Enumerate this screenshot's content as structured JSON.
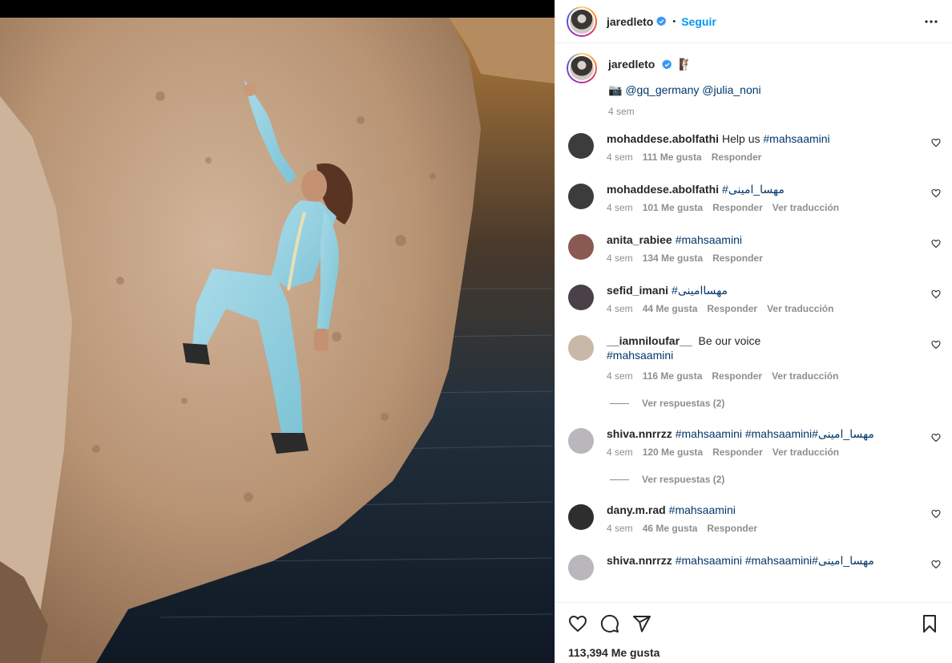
{
  "header": {
    "username": "jaredleto",
    "follow_label": "Seguir",
    "dot": "•"
  },
  "caption": {
    "username": "jaredleto",
    "emoji": "🧗🏽",
    "camera_emoji": "📷",
    "mention1": "@gq_germany",
    "mention2": "@julia_noni",
    "time": "4 sem"
  },
  "comments": [
    {
      "user": "mohaddese.abolfathi",
      "text": "Help us",
      "tag": "#mahsaamini",
      "time": "4 sem",
      "likes": "111 Me gusta",
      "reply": "Responder",
      "translate": "",
      "avatar": "#3c3c3c"
    },
    {
      "user": "mohaddese.abolfathi",
      "text": "",
      "tag": "#مهسا_امینی",
      "time": "4 sem",
      "likes": "101 Me gusta",
      "reply": "Responder",
      "translate": "Ver traducción",
      "avatar": "#3c3c3c"
    },
    {
      "user": "anita_rabiee",
      "text": "",
      "tag": "#mahsaamini",
      "time": "4 sem",
      "likes": "134 Me gusta",
      "reply": "Responder",
      "translate": "",
      "avatar": "#8a5a52"
    },
    {
      "user": "sefid_imani",
      "text": "",
      "tag": "#مهساامینی",
      "time": "4 sem",
      "likes": "44 Me gusta",
      "reply": "Responder",
      "translate": "Ver traducción",
      "avatar": "#4a4048"
    },
    {
      "user": "__iamniloufar__",
      "text": "Be our voice",
      "tag": "#mahsaamini",
      "time": "4 sem",
      "likes": "116 Me gusta",
      "reply": "Responder",
      "translate": "Ver traducción",
      "avatar": "#c9b8a8"
    },
    {
      "user": "shiva.nnrrzz",
      "text": "",
      "tag": "#mahsaamini #mahsaamini#مهسا_امینی",
      "time": "4 sem",
      "likes": "120 Me gusta",
      "reply": "Responder",
      "translate": "Ver traducción",
      "avatar": "#b9b6bc"
    },
    {
      "user": "dany.m.rad",
      "text": "",
      "tag": "#mahsaamini",
      "time": "4 sem",
      "likes": "46 Me gusta",
      "reply": "Responder",
      "translate": "",
      "avatar": "#2e2e2e"
    },
    {
      "user": "shiva.nnrrzz",
      "text": "",
      "tag": "#mahsaamini #mahsaamini#مهسا_امینی",
      "time": "",
      "likes": "",
      "reply": "",
      "translate": "",
      "avatar": "#b9b6bc"
    }
  ],
  "view_replies_1": "Ver respuestas (2)",
  "view_replies_2": "Ver respuestas (2)",
  "likes_count": "113,394 Me gusta",
  "colors": {
    "accent": "#0095f6",
    "link": "#00376b",
    "muted": "#8e8e8e",
    "verified": "#3897f0"
  }
}
